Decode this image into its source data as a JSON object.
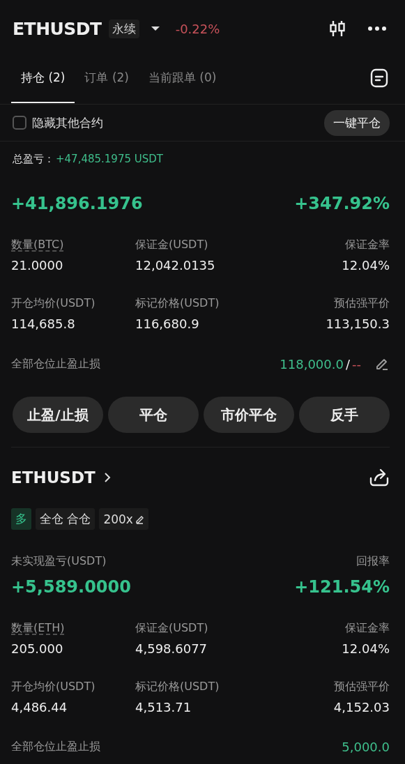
{
  "header": {
    "symbol": "ETHUSDT",
    "contract_type": "永续",
    "change": "-0.22%"
  },
  "tabs": [
    {
      "label": "持仓 (2)",
      "selected": true
    },
    {
      "label": "订单 (2)",
      "selected": false
    },
    {
      "label": "当前跟单 (0)",
      "selected": false
    }
  ],
  "filter": {
    "label": "隐藏其他合约",
    "checked": false
  },
  "close_all_button": "一键平仓",
  "total_pnl": {
    "label": "总盈亏：",
    "value": "+47,485.1975 USDT"
  },
  "positions": [
    {
      "pnl": "+41,896.1976",
      "roe": "+347.92%",
      "fields": [
        {
          "label": "数量(BTC)",
          "value": "21.0000"
        },
        {
          "label": "保证金(USDT)",
          "value": "12,042.0135"
        },
        {
          "label": "保证金率",
          "value": "12.04%"
        },
        {
          "label": "开仓均价(USDT)",
          "value": "114,685.8"
        },
        {
          "label": "标记价格(USDT)",
          "value": "116,680.9"
        },
        {
          "label": "预估强平价",
          "value": "113,150.3"
        }
      ],
      "tpsl": {
        "label": "全部仓位止盈止损",
        "tp": "118,000.0",
        "separator": "/",
        "sl": "--"
      },
      "actions": [
        "止盈/止损",
        "平仓",
        "市价平仓",
        "反手"
      ]
    },
    {
      "symbol": "ETHUSDT",
      "tags": [
        {
          "kind": "side",
          "label": "多"
        },
        {
          "kind": "mode",
          "label": "全仓 合仓"
        },
        {
          "kind": "leverage",
          "label": "200x"
        }
      ],
      "pnl_label": "未实现盈亏(USDT)",
      "roe_label": "回报率",
      "pnl": "+5,589.0000",
      "roe": "+121.54%",
      "fields": [
        {
          "label": "数量(ETH)",
          "value": "205.000"
        },
        {
          "label": "保证金(USDT)",
          "value": "4,598.6077"
        },
        {
          "label": "保证金率",
          "value": "12.04%"
        },
        {
          "label": "开仓均价(USDT)",
          "value": "4,486.44"
        },
        {
          "label": "标记价格(USDT)",
          "value": "4,513.71"
        },
        {
          "label": "预估强平价",
          "value": "4,152.03"
        }
      ],
      "tpsl": {
        "label": "全部仓位止盈止损",
        "tp": "5,000.0"
      }
    }
  ]
}
